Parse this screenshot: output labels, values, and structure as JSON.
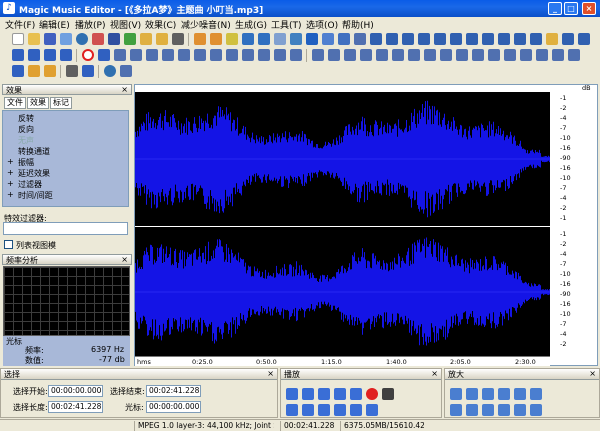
{
  "window": {
    "title": "Magic Music Editor - [《多拉A梦》主题曲 小叮当.mp3]",
    "controls": [
      "_",
      "□",
      "×"
    ]
  },
  "menu": [
    "文件(F)",
    "编辑(E)",
    "播放(P)",
    "视图(V)",
    "效果(C)",
    "减少噪音(N)",
    "生成(G)",
    "工具(T)",
    "选项(O)",
    "帮助(H)"
  ],
  "left_panel": {
    "title": "效果",
    "close": "×",
    "tabs": [
      "文件",
      "效果",
      "标记"
    ],
    "effects": [
      {
        "label": "反转",
        "prefix": ""
      },
      {
        "label": "反向",
        "prefix": ""
      },
      {
        "label": "无声",
        "prefix": ""
      },
      {
        "label": "转换通道",
        "prefix": ""
      },
      {
        "label": "振幅",
        "prefix": "+"
      },
      {
        "label": "延迟效果",
        "prefix": "+"
      },
      {
        "label": "过滤器",
        "prefix": "+"
      },
      {
        "label": "时间/间距",
        "prefix": "+"
      }
    ],
    "filter_label": "特效过滤器:",
    "filter_value": "",
    "list_view_label": "列表视图模"
  },
  "spectrum_panel": {
    "title": "频率分析",
    "close": "×",
    "cursor_label": "光标",
    "freq_label": "频率:",
    "freq_value": "6397 Hz",
    "value_label": "数值:",
    "value_value": "-77 db"
  },
  "waveform": {
    "db_unit": "dB",
    "db_ticks": [
      "-1",
      "-2",
      "-4",
      "-7",
      "-10",
      "-16",
      "-90",
      "-16",
      "-10",
      "-7",
      "-4",
      "-2",
      "-1"
    ],
    "ruler": [
      "hms",
      "0:25.0",
      "0:50.0",
      "1:15.0",
      "1:40.0",
      "2:05.0",
      "2:30.0"
    ],
    "colors": {
      "wave": "#1414e6",
      "background": "#000000",
      "center": "#3c3cff"
    }
  },
  "selection_panel": {
    "title": "选择",
    "close": "×",
    "start_label": "选择开始:",
    "start_value": "00:00:00.000",
    "end_label": "选择结束:",
    "end_value": "00:02:41.228",
    "length_label": "选择长度:",
    "length_value": "00:02:41.228",
    "cursor_label": "光标:",
    "cursor_value": "00:00:00.000"
  },
  "playback_panel": {
    "title": "播放",
    "close": "×"
  },
  "zoom_panel": {
    "title": "放大",
    "close": "×"
  },
  "status_bar": [
    "MPEG 1.0 layer-3: 44,100 kHz; Joint Stereo",
    "00:02:41.228",
    "6375.05MB/15610.42MB"
  ]
}
